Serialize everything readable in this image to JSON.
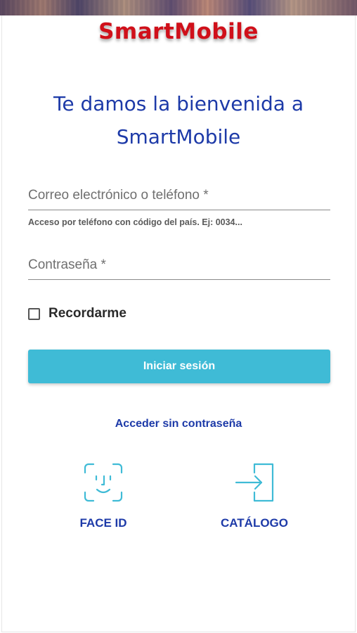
{
  "app": {
    "logo_text": "SmartMobile"
  },
  "welcome": {
    "line1": "Te damos la bienvenida a",
    "line2": "SmartMobile"
  },
  "form": {
    "email_placeholder": "Correo electrónico o teléfono *",
    "email_value": "",
    "email_hint": "Acceso por teléfono con código del país. Ej: 0034...",
    "password_placeholder": "Contraseña *",
    "password_value": "",
    "remember_label": "Recordarme",
    "remember_checked": false,
    "login_label": "Iniciar sesión"
  },
  "links": {
    "passwordless_label": "Acceder sin contraseña"
  },
  "actions": [
    {
      "label": "FACE ID",
      "icon": "face-id-icon"
    },
    {
      "label": "CATÁLOGO",
      "icon": "sign-in-icon"
    }
  ],
  "colors": {
    "brand_red": "#d0101a",
    "title_blue": "#1d3aa8",
    "accent_cyan": "#3fbbd6"
  }
}
